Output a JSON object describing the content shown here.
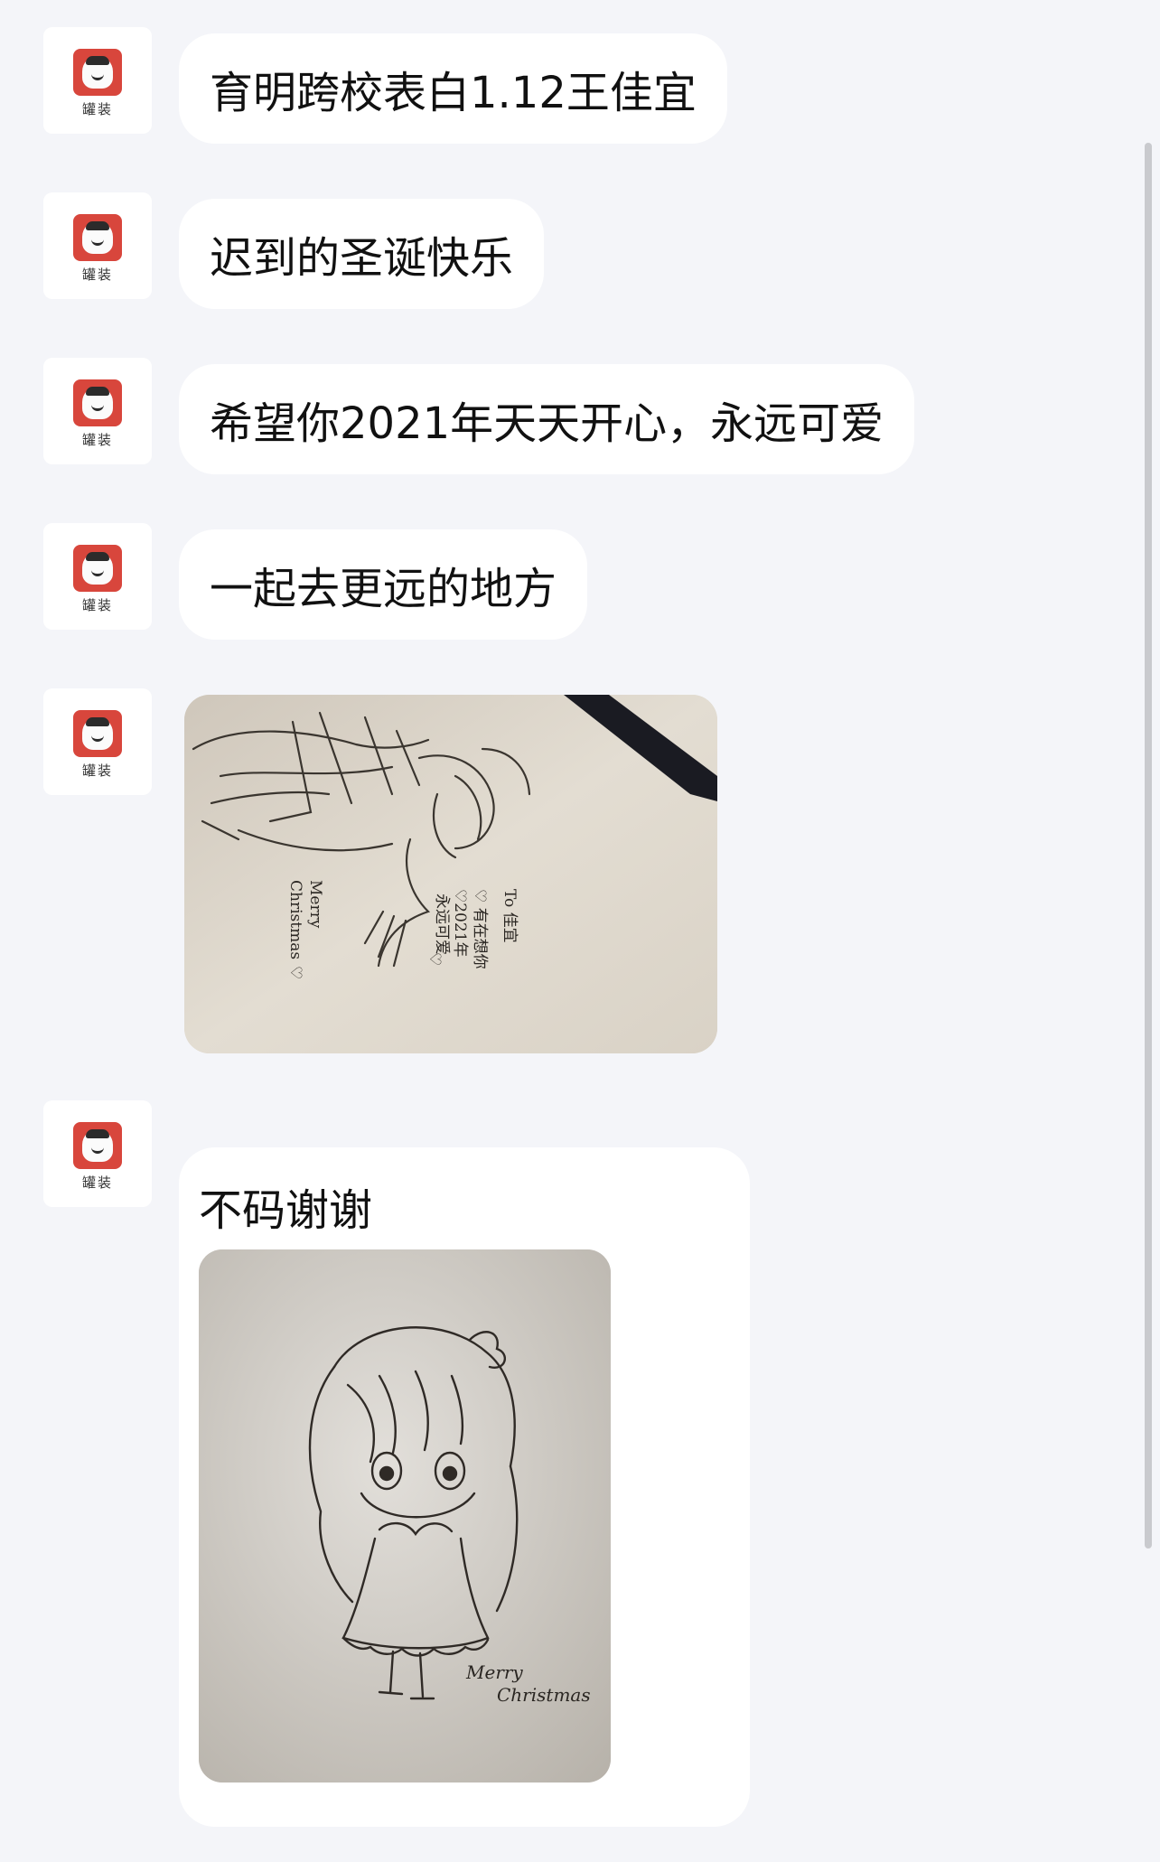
{
  "avatar": {
    "label": "罐装",
    "icon": "canned-character-avatar-icon",
    "colors": {
      "can": "#d8463c",
      "bg": "#ffffff"
    }
  },
  "messages": [
    {
      "type": "text",
      "text": "育明跨校表白1.12王佳宜"
    },
    {
      "type": "text",
      "text": "迟到的圣诞快乐"
    },
    {
      "type": "text",
      "text": "希望你2021年天天开心，永远可爱"
    },
    {
      "type": "text",
      "text": "一起去更远的地方"
    },
    {
      "type": "image",
      "image": {
        "description_icon": "drawing-photo-icon",
        "texts": [
          "To 佳宜",
          "♡ 有在想你",
          "♡2021年",
          "永远可爱",
          "♡",
          "Merry",
          "Christmas",
          "♡"
        ]
      }
    },
    {
      "type": "text-image",
      "text": "不码谢谢",
      "image": {
        "description_icon": "chibi-drawing-photo-icon",
        "texts": [
          "Merry",
          "Christmas"
        ]
      }
    }
  ],
  "colors": {
    "background": "#f4f5f9",
    "bubble": "#ffffff",
    "text": "#111111"
  }
}
